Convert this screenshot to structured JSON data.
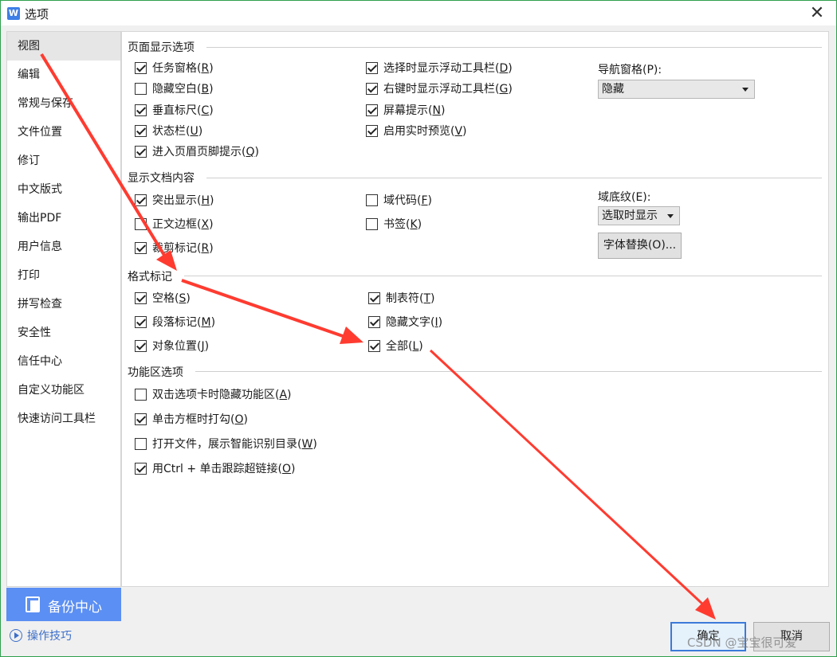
{
  "window": {
    "title": "选项",
    "app_icon": "W"
  },
  "sidebar": {
    "items": [
      {
        "label": "视图",
        "active": true
      },
      {
        "label": "编辑"
      },
      {
        "label": "常规与保存"
      },
      {
        "label": "文件位置"
      },
      {
        "label": "修订"
      },
      {
        "label": "中文版式"
      },
      {
        "label": "输出PDF"
      },
      {
        "label": "用户信息"
      },
      {
        "label": "打印"
      },
      {
        "label": "拼写检查"
      },
      {
        "label": "安全性"
      },
      {
        "label": "信任中心"
      },
      {
        "label": "自定义功能区"
      },
      {
        "label": "快速访问工具栏"
      }
    ],
    "backup_label": "备份中心",
    "tips_label": "操作技巧"
  },
  "page_display": {
    "title": "页面显示选项",
    "col1": [
      {
        "text": "任务窗格(",
        "key": "R",
        "checked": true
      },
      {
        "text": "隐藏空白(",
        "key": "B",
        "checked": false
      },
      {
        "text": "垂直标尺(",
        "key": "C",
        "checked": true
      },
      {
        "text": "状态栏(",
        "key": "U",
        "checked": true
      },
      {
        "text": "进入页眉页脚提示(",
        "key": "Q",
        "checked": true
      }
    ],
    "col2": [
      {
        "text": "选择时显示浮动工具栏(",
        "key": "D",
        "checked": true
      },
      {
        "text": "右键时显示浮动工具栏(",
        "key": "G",
        "checked": true
      },
      {
        "text": "屏幕提示(",
        "key": "N",
        "checked": true
      },
      {
        "text": "启用实时预览(",
        "key": "V",
        "checked": true
      }
    ],
    "nav_pane_label": "导航窗格(P):",
    "nav_pane_value": "隐藏"
  },
  "doc_content": {
    "title": "显示文档内容",
    "col1": [
      {
        "text": "突出显示(",
        "key": "H",
        "checked": true
      },
      {
        "text": "正文边框(",
        "key": "X",
        "checked": false
      },
      {
        "text": "裁剪标记(",
        "key": "R",
        "checked": true
      }
    ],
    "col2": [
      {
        "text": "域代码(",
        "key": "F",
        "checked": false
      },
      {
        "text": "书签(",
        "key": "K",
        "checked": false
      }
    ],
    "field_shading_label": "域底纹(E):",
    "field_shading_value": "选取时显示",
    "font_sub_button": "字体替换(O)..."
  },
  "format_marks": {
    "title": "格式标记",
    "col1": [
      {
        "text": "空格(",
        "key": "S",
        "checked": true
      },
      {
        "text": "段落标记(",
        "key": "M",
        "checked": true
      },
      {
        "text": "对象位置(",
        "key": "J",
        "checked": true
      }
    ],
    "col2": [
      {
        "text": "制表符(",
        "key": "T",
        "checked": true
      },
      {
        "text": "隐藏文字(",
        "key": "I",
        "checked": true
      },
      {
        "text": "全部(",
        "key": "L",
        "checked": true
      }
    ]
  },
  "ribbon": {
    "title": "功能区选项",
    "items": [
      {
        "text": "双击选项卡时隐藏功能区(",
        "key": "A",
        "checked": false
      },
      {
        "text": "单击方框时打勾(",
        "key": "O",
        "checked": true
      },
      {
        "text": "打开文件，展示智能识别目录(",
        "key": "W",
        "checked": false
      },
      {
        "text": "用Ctrl + 单击跟踪超链接(",
        "key": "O",
        "checked": true
      }
    ]
  },
  "footer": {
    "ok_label": "确定",
    "cancel_label": "取消"
  },
  "watermark": "CSDN @宝宝很可爱",
  "colors": {
    "accent": "#2fa04d",
    "backup_bg": "#5b8ff3",
    "arrow": "#ff3b30",
    "link": "#3c6fc9"
  }
}
